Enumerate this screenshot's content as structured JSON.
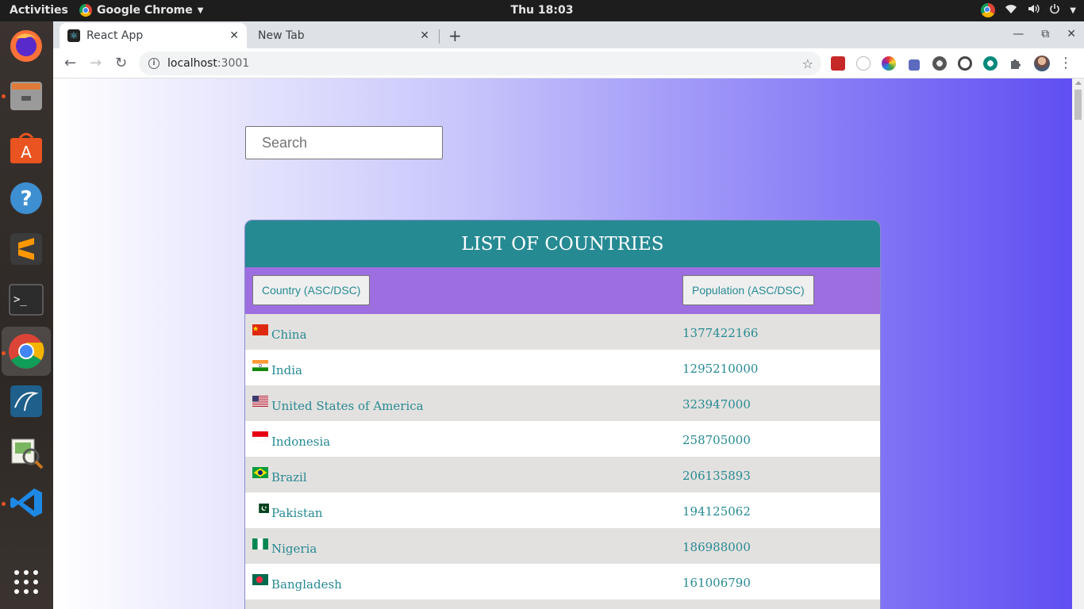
{
  "system": {
    "activities": "Activities",
    "app_name": "Google Chrome",
    "clock": "Thu 18:03"
  },
  "browser": {
    "tabs": [
      {
        "label": "React App",
        "active": true
      },
      {
        "label": "New Tab",
        "active": false
      }
    ],
    "url_host": "localhost",
    "url_port": ":3001"
  },
  "page": {
    "search_placeholder": "Search",
    "title": "LIST OF COUNTRIES",
    "sort_country_label": "Country (ASC/DSC)",
    "sort_population_label": "Population (ASC/DSC)",
    "countries": [
      {
        "name": "China",
        "population": "1377422166",
        "flag": "china"
      },
      {
        "name": "India",
        "population": "1295210000",
        "flag": "india"
      },
      {
        "name": "United States of America",
        "population": "323947000",
        "flag": "usa"
      },
      {
        "name": "Indonesia",
        "population": "258705000",
        "flag": "indonesia"
      },
      {
        "name": "Brazil",
        "population": "206135893",
        "flag": "brazil"
      },
      {
        "name": "Pakistan",
        "population": "194125062",
        "flag": "pakistan"
      },
      {
        "name": "Nigeria",
        "population": "186988000",
        "flag": "nigeria"
      },
      {
        "name": "Bangladesh",
        "population": "161006790",
        "flag": "bangladesh"
      }
    ]
  },
  "colors": {
    "header_teal": "#268a93",
    "sort_row_purple": "#9d6ee0",
    "row_alt": "#e3e1df",
    "gradient_end": "#5f4ff2"
  }
}
